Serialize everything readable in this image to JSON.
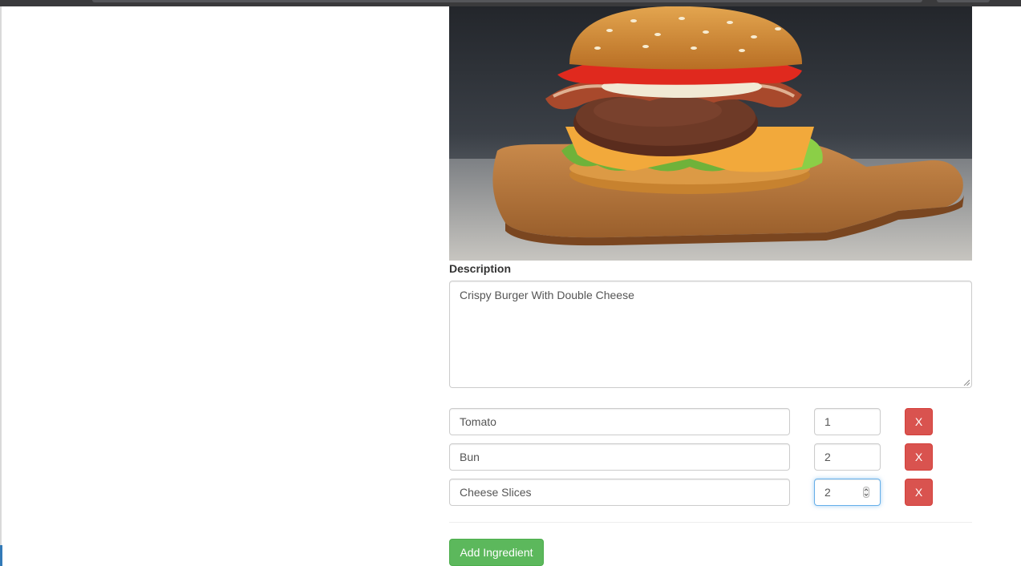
{
  "recipe": {
    "image_icon": "burger-photo",
    "description_label": "Description",
    "description_value": "Crispy Burger With Double Cheese"
  },
  "ingredients": [
    {
      "name": "Tomato",
      "amount": "1",
      "delete_label": "X"
    },
    {
      "name": "Bun",
      "amount": "2",
      "delete_label": "X"
    },
    {
      "name": "Cheese Slices",
      "amount": "2",
      "delete_label": "X"
    }
  ],
  "actions": {
    "add_ingredient_label": "Add Ingredient"
  },
  "colors": {
    "danger": "#d9534f",
    "success": "#5cb85c",
    "focus": "#66afe9"
  }
}
